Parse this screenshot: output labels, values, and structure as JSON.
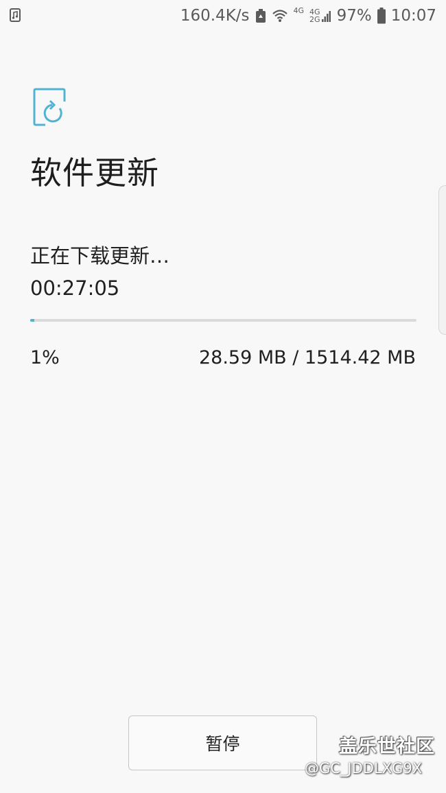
{
  "status_bar": {
    "left_icon": "music-note-icon",
    "speed": "160.4K/s",
    "net_4g_label": "4G",
    "net_4g_label_2": "4G",
    "net_2g_label": "2G",
    "battery": "97%",
    "time": "10:07"
  },
  "header": {
    "icon": "software-update-icon",
    "title": "软件更新"
  },
  "download": {
    "status": "正在下载更新…",
    "elapsed": "00:27:05",
    "progress_fraction": 0.01,
    "percent": "1%",
    "size": "28.59 MB / 1514.42 MB",
    "accent_color": "#4fb3d1"
  },
  "actions": {
    "pause_label": "暂停"
  },
  "watermark": {
    "title": "盖乐世社区",
    "user": "@GC_JDDLXG9X"
  }
}
